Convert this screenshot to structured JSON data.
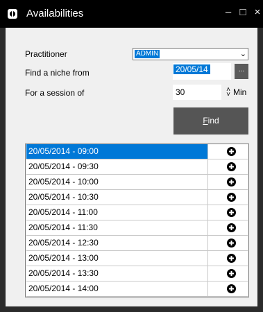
{
  "window": {
    "title": "Availabilities",
    "minimize": "–",
    "maximize": "□",
    "close": "×"
  },
  "form": {
    "practitioner_label": "Practitioner",
    "practitioner_value": "ADMIN",
    "niche_label": "Find a niche from",
    "niche_date": "20/05/14",
    "ellipsis": "...",
    "session_label": "For a session of",
    "session_value": "30",
    "session_unit": "Min",
    "find_key": "F",
    "find_rest": "ind"
  },
  "slots": [
    "20/05/2014 - 09:00",
    "20/05/2014 - 09:30",
    "20/05/2014 - 10:00",
    "20/05/2014 - 10:30",
    "20/05/2014 - 11:00",
    "20/05/2014 - 11:30",
    "20/05/2014 - 12:30",
    "20/05/2014 - 13:00",
    "20/05/2014 - 13:30",
    "20/05/2014 - 14:00"
  ],
  "selected_index": 0,
  "colors": {
    "selection": "#0078d7",
    "titlebar": "#000000",
    "find_button": "#555555"
  }
}
